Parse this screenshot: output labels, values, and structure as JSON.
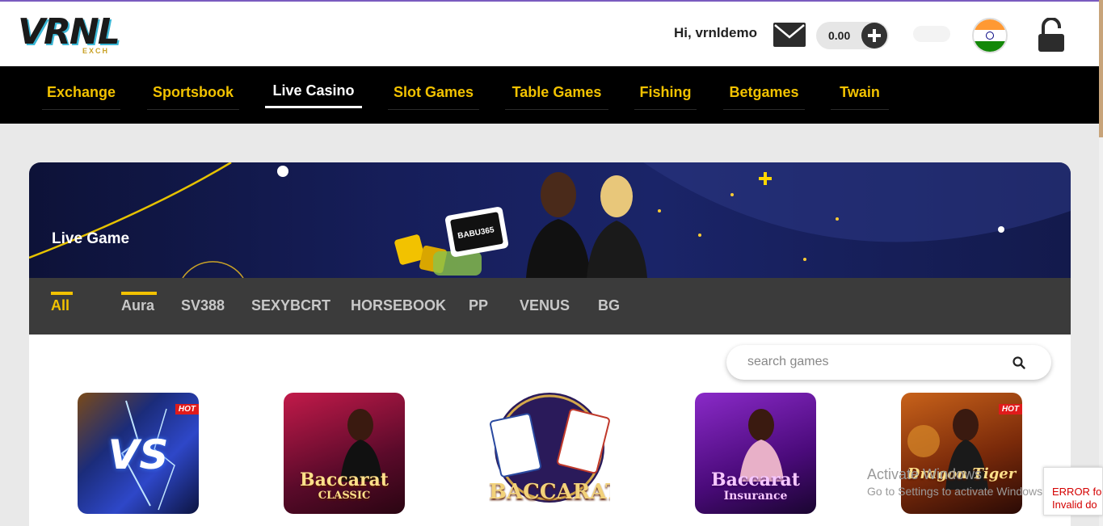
{
  "header": {
    "logo_text": "VRNL",
    "logo_sub": "EXCH",
    "greeting": "Hi, vrnldemo",
    "balance": "0.00"
  },
  "nav": {
    "items": [
      {
        "label": "Exchange"
      },
      {
        "label": "Sportsbook"
      },
      {
        "label": "Live Casino"
      },
      {
        "label": "Slot Games"
      },
      {
        "label": "Table Games"
      },
      {
        "label": "Fishing"
      },
      {
        "label": "Betgames"
      },
      {
        "label": "Twain"
      }
    ],
    "active_index": 2
  },
  "banner": {
    "title": "Live Game",
    "badge_text": "BABU365"
  },
  "provider_tabs": {
    "items": [
      {
        "label": "All"
      },
      {
        "label": "Aura"
      },
      {
        "label": "SV388"
      },
      {
        "label": "SEXYBCRT"
      },
      {
        "label": "HORSEBOOK"
      },
      {
        "label": "PP"
      },
      {
        "label": "VENUS"
      },
      {
        "label": "BG"
      }
    ],
    "active_index": 0
  },
  "search": {
    "placeholder": "search games"
  },
  "games": [
    {
      "art_text": "VS",
      "hot": true,
      "hot_text": "HOT"
    },
    {
      "art_text": "Baccarat",
      "art_sub": "CLASSIC",
      "hot": false
    },
    {
      "art_text": "BACCARAT",
      "hot": false
    },
    {
      "art_text": "Baccarat",
      "art_sub": "Insurance",
      "hot": false
    },
    {
      "art_text": "Dragon Tiger",
      "hot": true,
      "hot_text": "HOT"
    }
  ],
  "overlay": {
    "activate_title": "Activate Windows",
    "activate_sub": "Go to Settings to activate Windows.",
    "error_line1": "ERROR fo",
    "error_line2": "Invalid do"
  },
  "colors": {
    "nav_text": "#f2c200",
    "nav_bg": "#000000",
    "tab_bg": "#3b3b3b",
    "banner_bg": "#161e5a"
  }
}
